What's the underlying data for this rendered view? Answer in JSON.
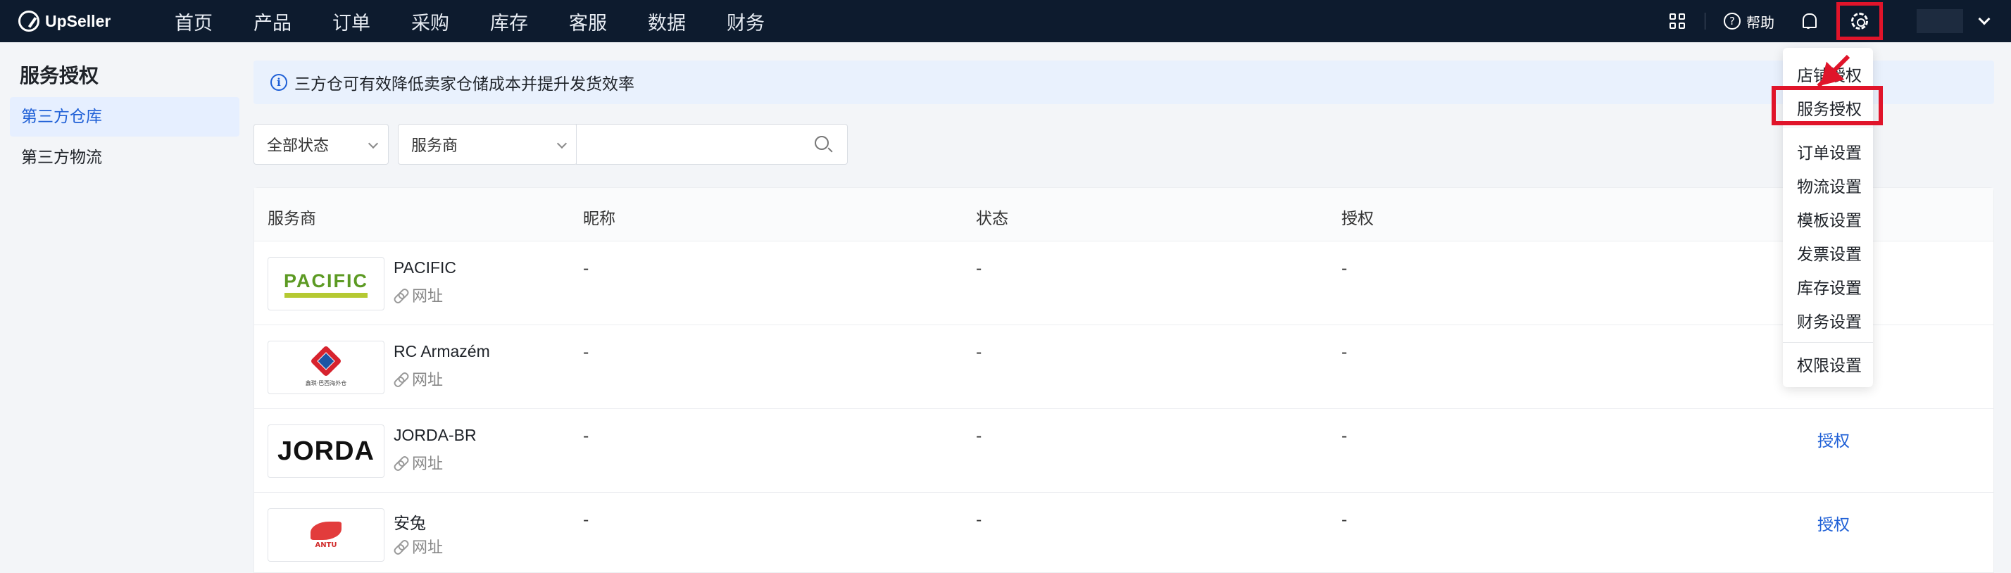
{
  "app": {
    "logo_text": "UpSeller"
  },
  "nav": {
    "items": [
      "首页",
      "产品",
      "订单",
      "采购",
      "库存",
      "客服",
      "数据",
      "财务"
    ]
  },
  "topbar": {
    "help_label": "帮助",
    "help_glyph": "?"
  },
  "sidebar": {
    "title": "服务授权",
    "items": [
      {
        "label": "第三方仓库",
        "active": true
      },
      {
        "label": "第三方物流",
        "active": false
      }
    ]
  },
  "banner": {
    "text": "三方仓可有效降低卖家仓储成本并提升发货效率",
    "icon_glyph": "i"
  },
  "filters": {
    "status": "全部状态",
    "provider": "服务商",
    "search_placeholder": ""
  },
  "table": {
    "headers": {
      "provider": "服务商",
      "nickname": "昵称",
      "status": "状态",
      "auth": "授权"
    },
    "rows": [
      {
        "name": "PACIFIC",
        "link": "网址",
        "nickname": "-",
        "status": "-",
        "auth": "-",
        "action": "",
        "logo": "PACIFIC"
      },
      {
        "name": "RC Armazém",
        "link": "网址",
        "nickname": "-",
        "status": "-",
        "auth": "-",
        "action": "",
        "logo": "鑫琪·巴西海外仓"
      },
      {
        "name": "JORDA-BR",
        "link": "网址",
        "nickname": "-",
        "status": "-",
        "auth": "-",
        "action": "授权",
        "logo": "JORDA"
      },
      {
        "name": "安兔",
        "link": "网址",
        "nickname": "-",
        "status": "-",
        "auth": "-",
        "action": "授权",
        "logo": "ANTU"
      }
    ]
  },
  "dropdown": {
    "items": [
      "店铺授权",
      "服务授权",
      "订单设置",
      "物流设置",
      "模板设置",
      "发票设置",
      "库存设置",
      "财务设置",
      "权限设置"
    ],
    "highlighted": "服务授权"
  },
  "colors": {
    "topbar": "#0d1b2e",
    "accent": "#1e5fd6",
    "highlight": "#e0142a"
  }
}
